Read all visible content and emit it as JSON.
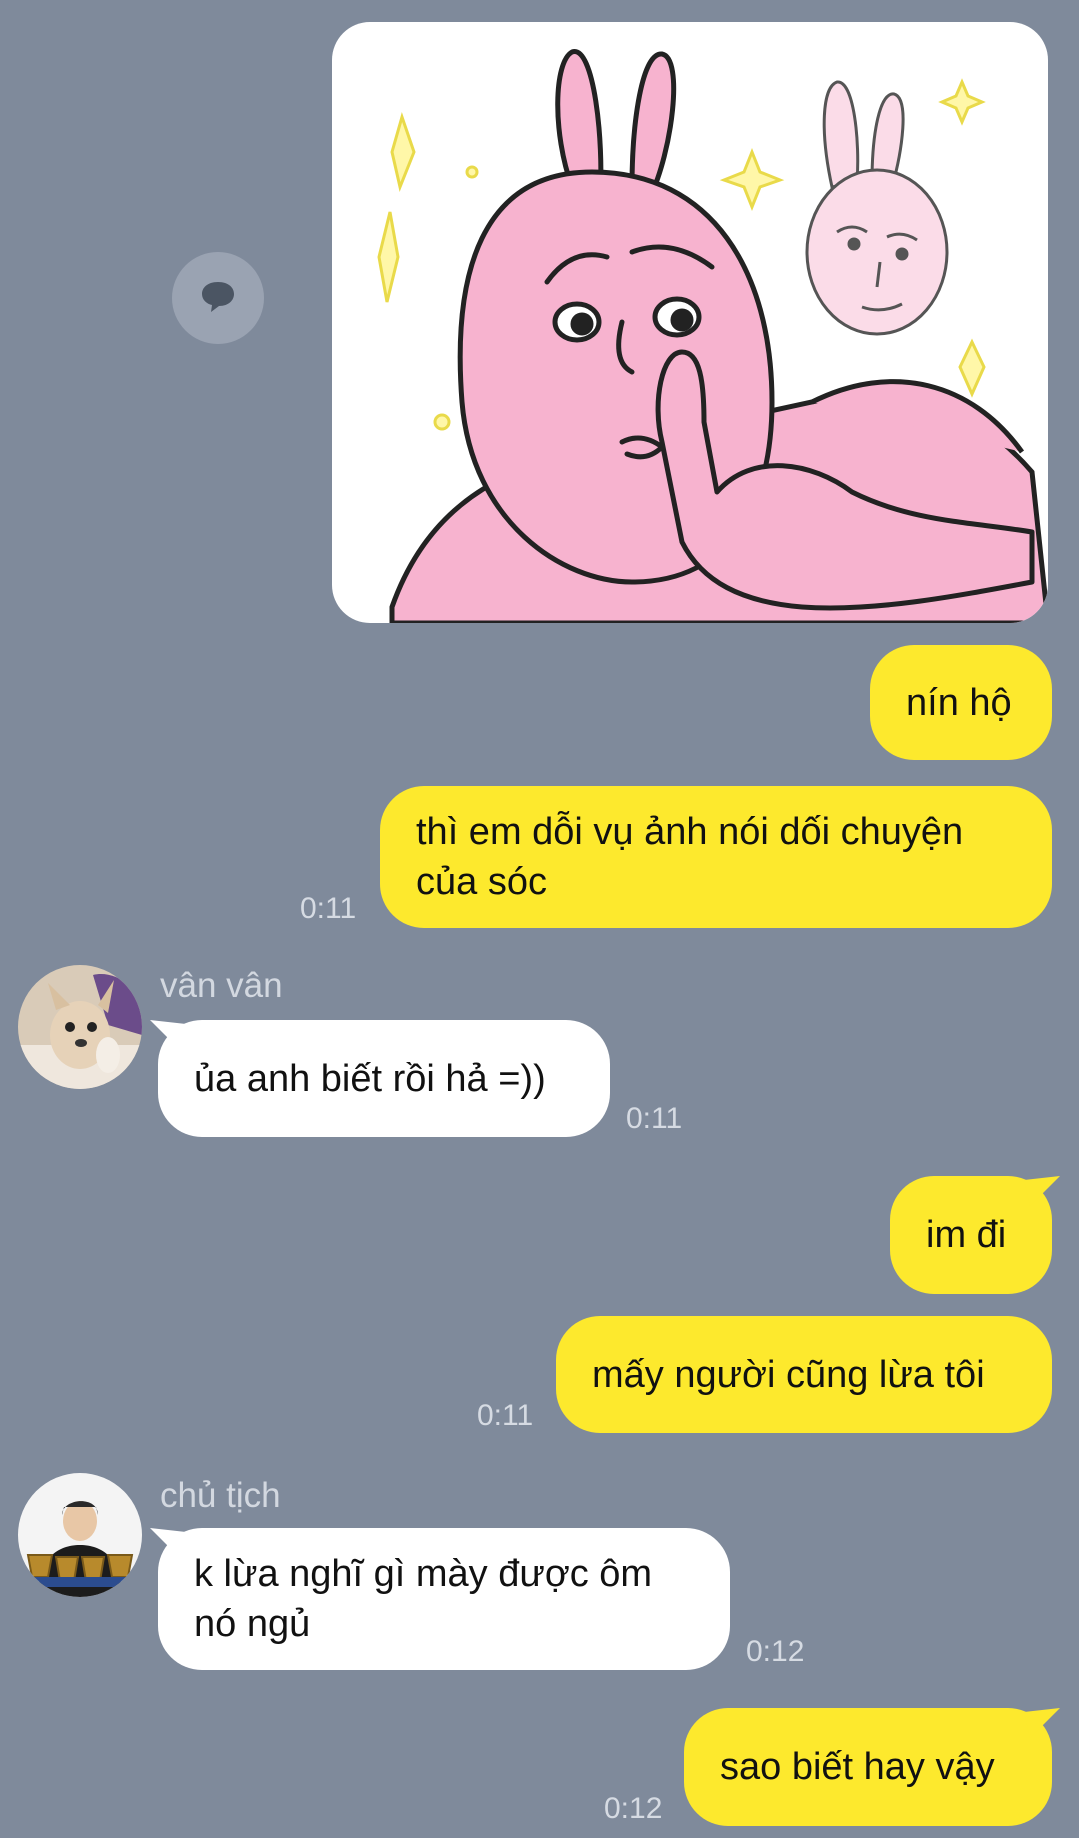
{
  "messages": [
    {
      "type": "sticker",
      "direction": "out",
      "sticker_name": "pink-rabbit-shush-sticker"
    },
    {
      "type": "text",
      "direction": "out",
      "text": "nín hộ"
    },
    {
      "type": "text",
      "direction": "out",
      "text": "thì em dỗi vụ ảnh nói dối chuyện của sóc",
      "line1": "thì em dỗi vụ ảnh nói dối chuyện",
      "line2": "của sóc",
      "time": "0:11"
    },
    {
      "type": "text",
      "direction": "in",
      "sender": "vân vân",
      "text": "ủa anh biết rồi hả =))",
      "time": "0:11"
    },
    {
      "type": "text",
      "direction": "out",
      "text": "im đi"
    },
    {
      "type": "text",
      "direction": "out",
      "text": "mấy người cũng lừa tôi",
      "time": "0:11"
    },
    {
      "type": "text",
      "direction": "in",
      "sender": "chủ tịch",
      "text": "k lừa nghĩ gì mày được ôm nó ngủ",
      "line1": "k lừa nghĩ gì mày được ôm",
      "line2": "nó ngủ",
      "time": "0:12"
    },
    {
      "type": "text",
      "direction": "out",
      "text": "sao biết hay vậy",
      "time": "0:12"
    }
  ],
  "colors": {
    "background": "#7f8a9b",
    "outgoing_bubble": "#fde92d",
    "incoming_bubble": "#ffffff",
    "timestamp": "#d6dbe3",
    "sender_name": "#d3d8e0",
    "sticker_pink": "#f7b3cf"
  },
  "icons": {
    "chat_action": "speech-bubble-icon",
    "avatar_1": "chihuahua-avatar",
    "avatar_2": "person-with-trophies-avatar"
  }
}
